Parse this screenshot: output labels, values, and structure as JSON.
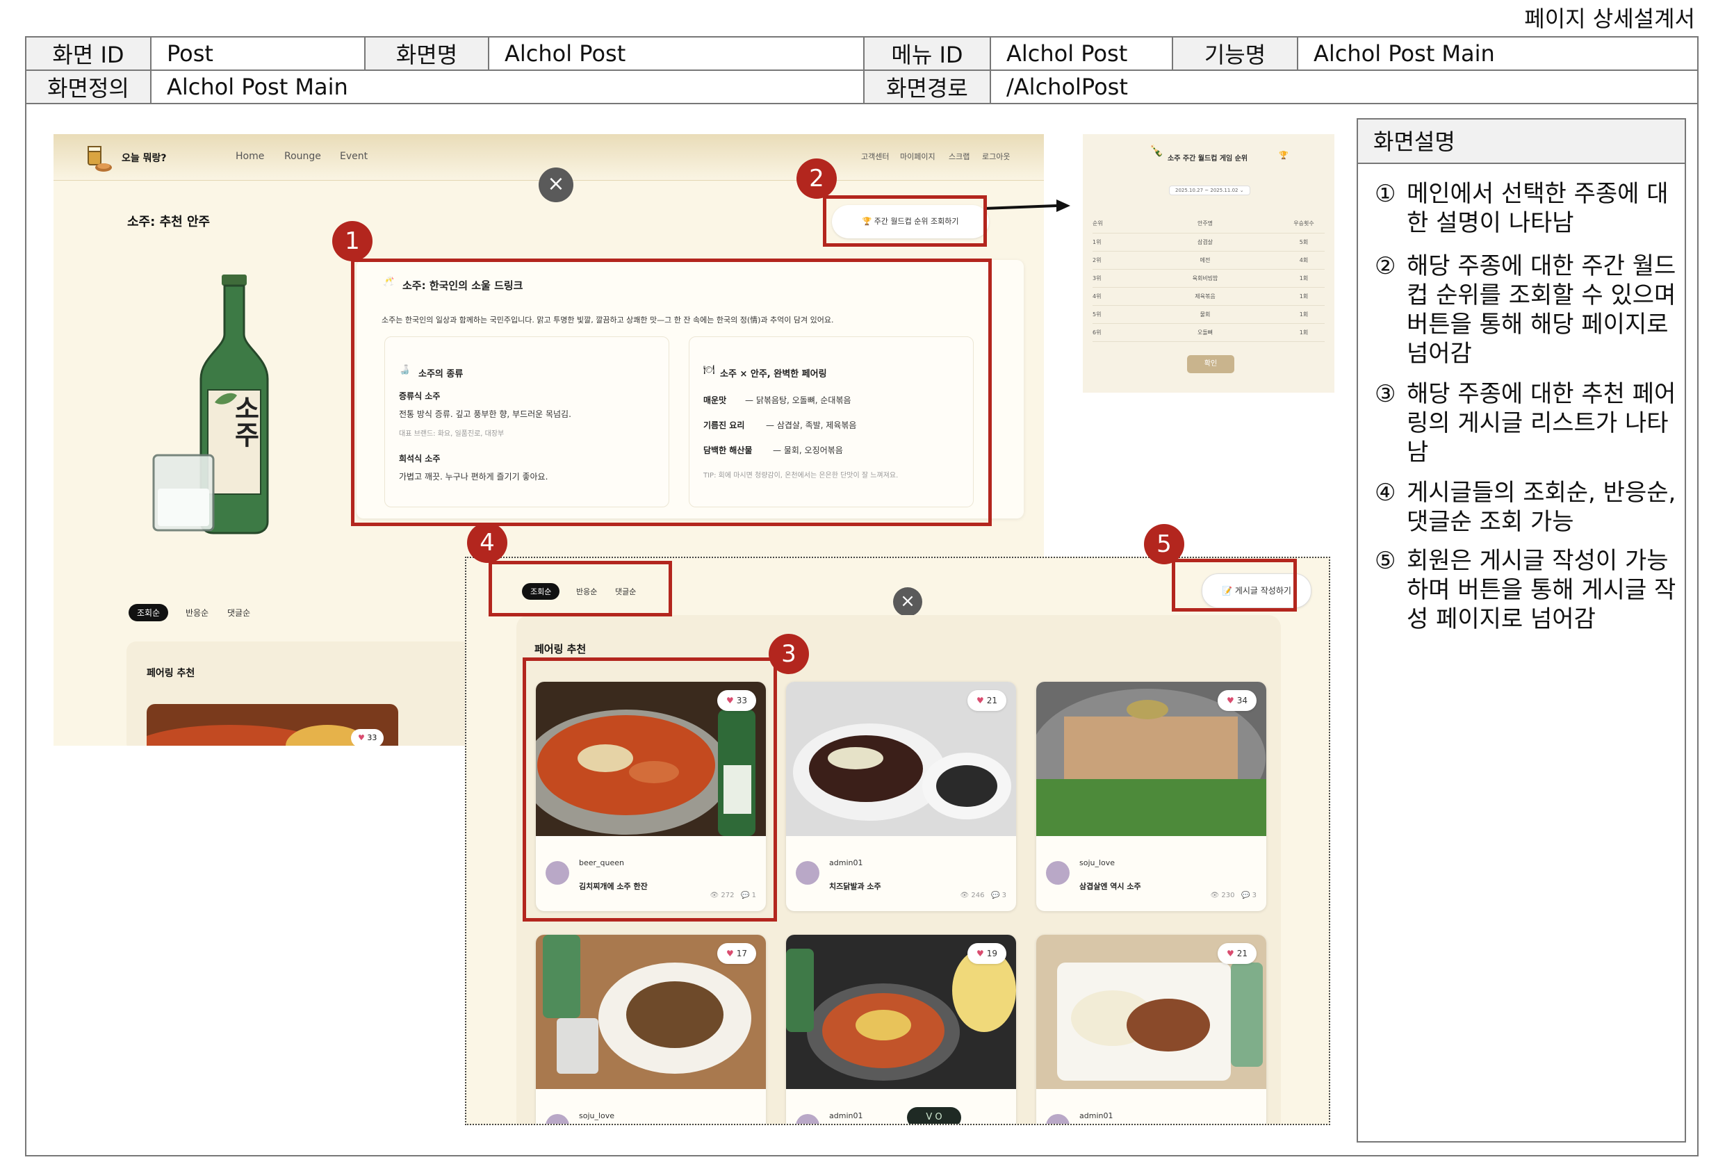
{
  "doc_title": "페이지 상세설계서",
  "header": {
    "row1": [
      {
        "label": "화면 ID",
        "value": "Post"
      },
      {
        "label": "화면명",
        "value": "Alchol Post"
      },
      {
        "label": "메뉴 ID",
        "value": "Alchol Post"
      },
      {
        "label": "기능명",
        "value": "Alchol Post Main"
      }
    ],
    "row2": [
      {
        "label": "화면정의",
        "value": "Alchol Post Main"
      },
      {
        "label": "화면경로",
        "value": "/AlcholPost"
      }
    ]
  },
  "site": {
    "logo_text": "오늘 뭐랑?",
    "nav": [
      "Home",
      "Rounge",
      "Event"
    ],
    "util_nav": [
      "고객센터",
      "마이페이지",
      "스크랩",
      "로그아웃"
    ],
    "close_symbol": "×"
  },
  "main": {
    "section_title": "소주: 추천 안주",
    "bottle_label": "소주",
    "desc_title": "소주: 한국인의 소울 드링크",
    "desc_text": "소주는 한국인의 일상과 함께하는 국민주입니다. 맑고 투명한 빛깔, 깔끔하고 상쾌한 맛—그 한 잔 속에는 한국의 정(情)과 추억이 담겨 있어요.",
    "types_title": "소주의 종류",
    "type1_name": "증류식 소주",
    "type1_desc": "전통 방식 증류. 깊고 풍부한 향, 부드러운 목넘김.",
    "type1_examples": "대표 브랜드: 화요, 일품진로, 대장부",
    "type2_name": "희석식 소주",
    "type2_desc": "가볍고 깨끗. 누구나 편하게 즐기기 좋아요.",
    "pairing_title": "소주 × 안주, 완벽한 페어링",
    "pair1_label": "매운맛",
    "pair1_text": "닭볶음탕, 오돌뼈, 순대볶음",
    "pair2_label": "기름진 요리",
    "pair2_text": "삼겹살, 족발, 제육볶음",
    "pair3_label": "담백한 해산물",
    "pair3_text": "물회, 오징어볶음",
    "tip": "TIP: 회에 마시면 청량감이, 온천에서는 은은한 단맛이 잘 느껴져요.",
    "weekly_button": "주간 월드컵 순위 조회하기",
    "sort_tabs": [
      "조회순",
      "반응순",
      "댓글순"
    ],
    "pairing_section": "페어링 추천",
    "peek_likes": "33"
  },
  "ranking": {
    "title": "소주 주간 월드컵 게임 순위",
    "date_range": "2025.10.27 ~ 2025.11.02",
    "columns": [
      "순위",
      "안주명",
      "우승횟수"
    ],
    "rows": [
      [
        "1위",
        "삼겹살",
        "5회"
      ],
      [
        "2위",
        "메전",
        "4회"
      ],
      [
        "3위",
        "육회비빔밥",
        "1회"
      ],
      [
        "4위",
        "제육볶음",
        "1회"
      ],
      [
        "5위",
        "물회",
        "1회"
      ],
      [
        "6위",
        "오돌뼈",
        "1회"
      ]
    ],
    "confirm": "확인"
  },
  "posts": {
    "write_button": "게시글 작성하기",
    "sort_tabs": [
      "조회순",
      "반응순",
      "댓글순"
    ],
    "section": "페어링 추천",
    "cards": [
      {
        "author": "beer_queen",
        "title": "김치찌개에 소주 한잔",
        "likes": "33",
        "views": "272",
        "comments": "1"
      },
      {
        "author": "admin01",
        "title": "치즈닭발과 소주",
        "likes": "21",
        "views": "246",
        "comments": "3"
      },
      {
        "author": "soju_love",
        "title": "삼겹살엔 역시 소주",
        "likes": "34",
        "views": "230",
        "comments": "3"
      },
      {
        "author": "soju_love",
        "likes": "17"
      },
      {
        "author": "admin01",
        "likes": "19"
      },
      {
        "author": "admin01",
        "likes": "21"
      }
    ],
    "pager": "V O"
  },
  "annotations": [
    "1",
    "2",
    "3",
    "4",
    "5"
  ],
  "description": {
    "title": "화면설명",
    "items": [
      {
        "num": "①",
        "text": "메인에서 선택한 주종에 대한 설명이 나타남"
      },
      {
        "num": "②",
        "text": "해당 주종에 대한 주간 월드컵 순위를 조회할 수 있으며 버튼을 통해 해당 페이지로 넘어감"
      },
      {
        "num": "③",
        "text": "해당 주종에 대한 추천 페어링의 게시글 리스트가 나타남"
      },
      {
        "num": "④",
        "text": "게시글들의 조회순, 반응순, 댓글순 조회 가능"
      },
      {
        "num": "⑤",
        "text": "회원은 게시글 작성이 가능하며 버튼을 통해 게시글 작성 페이지로 넘어감"
      }
    ]
  },
  "colors": {
    "annotation_red": "#b3261e",
    "page_bg": "#fbf6e6",
    "like_heart": "#d94c6f"
  }
}
